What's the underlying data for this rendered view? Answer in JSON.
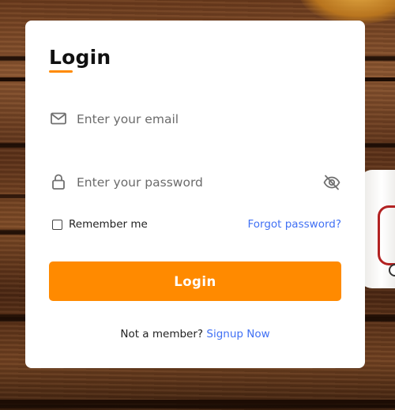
{
  "form": {
    "title": "Login",
    "email": {
      "placeholder": "Enter your email",
      "value": "",
      "icon": "envelope-icon"
    },
    "password": {
      "placeholder": "Enter your password",
      "value": "",
      "icon": "lock-icon",
      "toggle_icon": "eye-slash-icon"
    },
    "remember_label": "Remember me",
    "remember_checked": false,
    "forgot_label": "Forgot password?",
    "submit_label": "Login",
    "signup_prompt": "Not a member?",
    "signup_link": "Signup Now"
  },
  "colors": {
    "accent": "#ff8a00",
    "link": "#4070f4",
    "card": "#ffffff"
  }
}
